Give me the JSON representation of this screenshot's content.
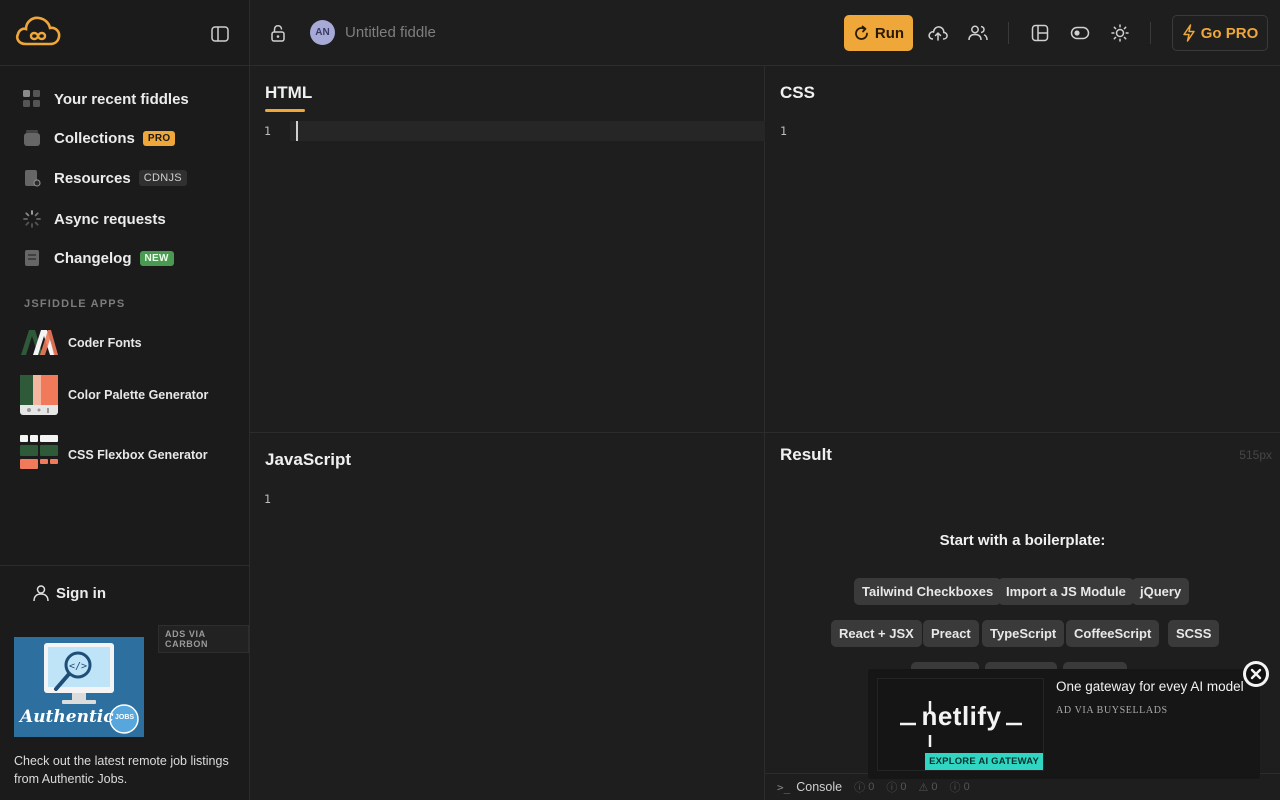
{
  "sidebar": {
    "nav": [
      {
        "label": "Your recent fiddles",
        "icon": "grid-icon"
      },
      {
        "label": "Collections",
        "icon": "collection-icon",
        "badge": "PRO"
      },
      {
        "label": "Resources",
        "icon": "document-icon",
        "badge": "CDNJS"
      },
      {
        "label": "Async requests",
        "icon": "spinner-icon"
      },
      {
        "label": "Changelog",
        "icon": "changelog-icon",
        "badge": "NEW"
      }
    ],
    "apps_heading": "JSFIDDLE APPS",
    "apps": [
      {
        "label": "Coder Fonts"
      },
      {
        "label": "Color Palette Generator"
      },
      {
        "label": "CSS Flexbox Generator"
      }
    ],
    "sign_in": "Sign in",
    "ad": {
      "tag": "ADS VIA CARBON",
      "brand": "Authentic",
      "badge": "JOBS",
      "text": "Check out the latest remote job listings from Authentic Jobs."
    }
  },
  "header": {
    "avatar_initials": "AN",
    "fiddle_title": "Untitled fiddle",
    "run_label": "Run",
    "go_pro_label": "Go PRO"
  },
  "panels": {
    "html": {
      "title": "HTML",
      "line": "1"
    },
    "css": {
      "title": "CSS",
      "line": "1"
    },
    "js": {
      "title": "JavaScript",
      "line": "1"
    },
    "result": {
      "title": "Result",
      "size": "515px",
      "boilerplate_title": "Start with a boilerplate:",
      "chips_row1": [
        "Tailwind Checkboxes",
        "Import a JS Module",
        "jQuery"
      ],
      "chips_row2": [
        "React + JSX",
        "Preact",
        "TypeScript",
        "CoffeeScript",
        "SCSS"
      ]
    }
  },
  "console": {
    "label": "Console",
    "counts": [
      "0",
      "0",
      "0",
      "0"
    ]
  },
  "netlify_ad": {
    "logo": "netlify",
    "cta": "EXPLORE AI GATEWAY",
    "headline": "One gateway for evey AI model",
    "via": "AD VIA BUYSELLADS"
  },
  "colors": {
    "accent": "#f0a73a",
    "background": "#1e1e1e",
    "sidebar": "#1b1b1b",
    "new_badge": "#4a9a52",
    "netlify_cta": "#30d6c2"
  }
}
